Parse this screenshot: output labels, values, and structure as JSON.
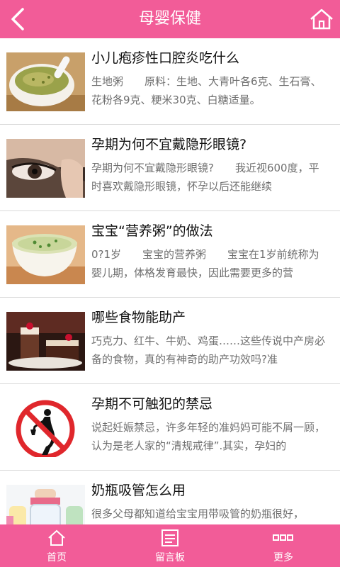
{
  "header": {
    "title": "母婴保健",
    "back_icon": "back-arrow-icon",
    "home_icon": "home-icon"
  },
  "articles": [
    {
      "title": "小儿疱疹性口腔炎吃什么",
      "desc": "生地粥　　原料：生地、大青叶各6克、生石膏、花粉各9克、粳米30克、白糖适量。",
      "image": "green-porridge-bowl"
    },
    {
      "title": "孕期为何不宜戴隐形眼镜?",
      "desc": "孕期为何不宜戴隐形眼镜?　　我近视600度，平时喜欢戴隐形眼镜，怀孕以后还能继续",
      "image": "eye-contact-lens"
    },
    {
      "title": "宝宝“营养粥”的做法",
      "desc": "0?1岁　　宝宝的营养粥　　宝宝在1岁前统称为婴儿期，体格发育最快，因此需要更多的营",
      "image": "nutrition-porridge-cup"
    },
    {
      "title": "哪些食物能助产",
      "desc": "巧克力、红牛、牛奶、鸡蛋……这些传说中产房必备的食物，真的有神奇的助产功效吗?准",
      "image": "chocolate-cake"
    },
    {
      "title": "孕期不可触犯的禁忌",
      "desc": "说起妊娠禁忌，许多年轻的准妈妈可能不屑一顾，认为是老人家的“清规戒律”.其实，孕妇的",
      "image": "pregnant-no-drinking-sign"
    },
    {
      "title": "奶瓶吸管怎么用",
      "desc": "很多父母都知道给宝宝用带吸管的奶瓶很好，",
      "image": "baby-bottles"
    }
  ],
  "bottom_nav": [
    {
      "label": "首页",
      "icon": "home-icon"
    },
    {
      "label": "留言板",
      "icon": "message-board-icon"
    },
    {
      "label": "更多",
      "icon": "more-dots-icon"
    }
  ],
  "colors": {
    "accent": "#f25c98",
    "title_text": "#111111",
    "desc_text": "#6f6f6f",
    "divider": "#d9d9d9"
  }
}
